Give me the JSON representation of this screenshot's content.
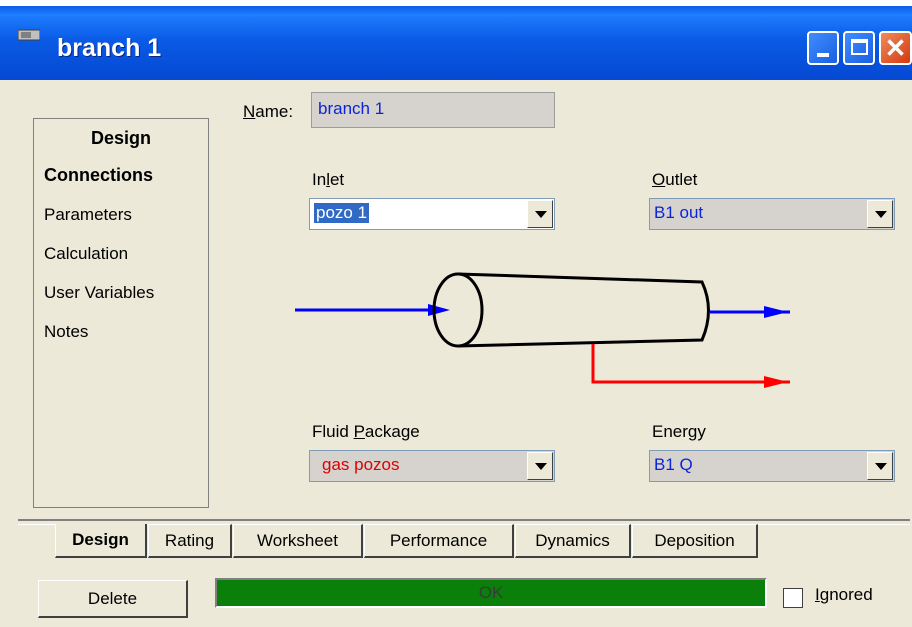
{
  "window": {
    "title": "branch 1",
    "icon": "app-icon"
  },
  "nav": {
    "header": "Design",
    "items": [
      "Connections",
      "Parameters",
      "Calculation",
      "User Variables",
      "Notes"
    ],
    "selected": "Connections"
  },
  "form": {
    "name_label_u": "N",
    "name_label_rest": "ame:",
    "name_value": "branch 1",
    "inlet_label_pre": "In",
    "inlet_label_u": "l",
    "inlet_label_post": "et",
    "inlet_value": "pozo 1",
    "outlet_label_u": "O",
    "outlet_label_rest": "utlet",
    "outlet_value": "B1 out",
    "fluid_label_pre": "Fluid ",
    "fluid_label_u": "P",
    "fluid_label_post": "ackage",
    "fluid_value": "gas pozos",
    "energy_label_pre": "Ener",
    "energy_label_u": "g",
    "energy_label_post": "y",
    "energy_value": "B1 Q"
  },
  "tabs": [
    "Design",
    "Rating",
    "Worksheet",
    "Performance",
    "Dynamics",
    "Deposition"
  ],
  "active_tab": "Design",
  "footer": {
    "delete_label": "Delete",
    "status_text": "OK",
    "ignored_label_u": "I",
    "ignored_label_rest": "gnored",
    "ignored_checked": false
  },
  "colors": {
    "titlebar": "#0a5be6",
    "inlet_stream": "#0000ff",
    "outlet_stream": "#0000ff",
    "liquid_stream": "#ff0000",
    "status_ok": "#0a800a"
  }
}
